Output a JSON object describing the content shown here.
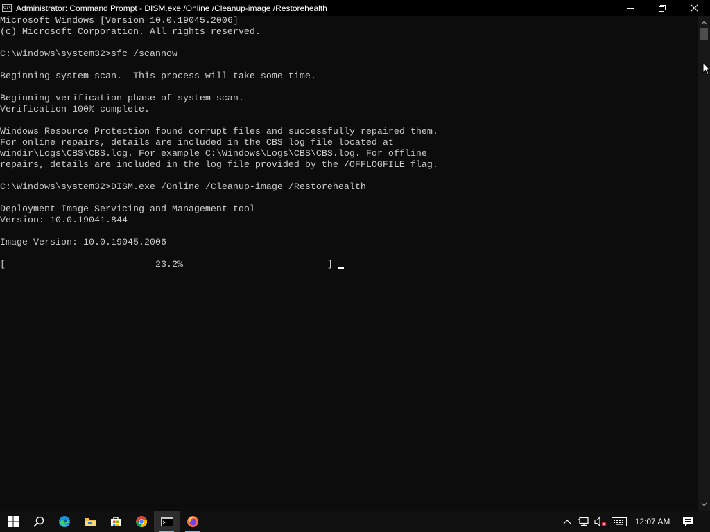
{
  "window": {
    "title": "Administrator: Command Prompt - DISM.exe  /Online /Cleanup-image /Restorehealth",
    "icon_text": "C:\\"
  },
  "console": {
    "lines": [
      "Microsoft Windows [Version 10.0.19045.2006]",
      "(c) Microsoft Corporation. All rights reserved.",
      "",
      "C:\\Windows\\system32>sfc /scannow",
      "",
      "Beginning system scan.  This process will take some time.",
      "",
      "Beginning verification phase of system scan.",
      "Verification 100% complete.",
      "",
      "Windows Resource Protection found corrupt files and successfully repaired them.",
      "For online repairs, details are included in the CBS log file located at",
      "windir\\Logs\\CBS\\CBS.log. For example C:\\Windows\\Logs\\CBS\\CBS.log. For offline",
      "repairs, details are included in the log file provided by the /OFFLOGFILE flag.",
      "",
      "C:\\Windows\\system32>DISM.exe /Online /Cleanup-image /Restorehealth",
      "",
      "Deployment Image Servicing and Management tool",
      "Version: 10.0.19041.844",
      "",
      "Image Version: 10.0.19045.2006",
      "",
      "[=============              23.2%                          ]"
    ],
    "progress_percent": 23.2
  },
  "taskbar": {
    "apps": [
      {
        "name": "start",
        "icon": "windows-logo-icon"
      },
      {
        "name": "search",
        "icon": "search-icon"
      },
      {
        "name": "edge",
        "icon": "edge-icon"
      },
      {
        "name": "file-explorer",
        "icon": "folder-icon"
      },
      {
        "name": "store",
        "icon": "store-icon"
      },
      {
        "name": "chrome",
        "icon": "chrome-icon"
      },
      {
        "name": "command-prompt",
        "icon": "cmd-icon",
        "active": true
      },
      {
        "name": "firefox",
        "icon": "firefox-icon",
        "running": true
      }
    ],
    "clock": "12:07 AM",
    "accent": "#76b9ed"
  },
  "colors": {
    "console_bg": "#0c0c0c",
    "console_text": "#cccccc",
    "titlebar_bg": "#000000",
    "taskbar_bg": "#101010"
  }
}
